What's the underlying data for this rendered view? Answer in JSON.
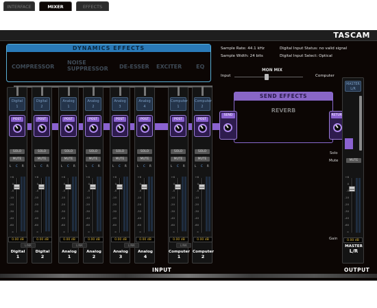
{
  "tabs": [
    {
      "label": "INTERFACE"
    },
    {
      "label": "MIXER"
    },
    {
      "label": "EFFECTS"
    }
  ],
  "brand": "TASCAM",
  "info": {
    "sample_rate": "Sample Rate: 44.1 kHz",
    "sample_width": "Sample Width: 24 bits",
    "digital_status": "Digital Input Status: no valid signal",
    "digital_select": "Digital Input Select: Optical"
  },
  "dynamics": {
    "title": "DYNAMICS EFFECTS",
    "items": [
      "COMPRESSOR",
      "NOISE\nSUPPRESSOR",
      "DE-ESSER",
      "EXCITER",
      "EQ"
    ]
  },
  "monmix": {
    "title": "MON MIX",
    "left": "Input",
    "right": "Computer"
  },
  "send_effects": {
    "title": "SEND EFFECTS",
    "effect": "REVERB",
    "send_label": "SEND",
    "return_label": "RETURN"
  },
  "channels": [
    {
      "btn1": "Digital",
      "btn2": "1",
      "name1": "Digital",
      "name2": "1",
      "db": "0.00 dB"
    },
    {
      "btn1": "Digital",
      "btn2": "2",
      "name1": "Digital",
      "name2": "2",
      "db": "0.00 dB"
    },
    {
      "btn1": "Analog",
      "btn2": "1",
      "name1": "Analog",
      "name2": "1",
      "db": "0.00 dB"
    },
    {
      "btn1": "Analog",
      "btn2": "2",
      "name1": "Analog",
      "name2": "2",
      "db": "0.00 dB"
    },
    {
      "btn1": "Analog",
      "btn2": "3",
      "name1": "Analog",
      "name2": "3",
      "db": "0.00 dB"
    },
    {
      "btn1": "Analog",
      "btn2": "4",
      "name1": "Analog",
      "name2": "4",
      "db": "0.00 dB"
    },
    {
      "btn1": "Computer",
      "btn2": "1",
      "name1": "Computer",
      "name2": "1",
      "db": "0.00 dB"
    },
    {
      "btn1": "Computer",
      "btn2": "2",
      "name1": "Computer",
      "name2": "2",
      "db": "0.00 dB"
    }
  ],
  "strip_labels": {
    "post": "POST",
    "solo": "SOLO",
    "mute": "MUTE",
    "l": "L",
    "c": "C",
    "r": "R",
    "link": "LINK"
  },
  "scale": [
    "+6",
    "0",
    "-5",
    "-10",
    "-20",
    "-30",
    "-40",
    "-60",
    "∞"
  ],
  "master": {
    "btn1": "MASTER",
    "btn2": "L/R",
    "mute": "MUTE",
    "name1": "MASTER",
    "name2": "L/R",
    "db": "0.00 dB"
  },
  "side_labels": {
    "solo": "Solo",
    "mute": "Mute",
    "gain": "Gain"
  },
  "sections": {
    "input": "INPUT",
    "output": "OUTPUT"
  },
  "colors": {
    "accent_purple": "#8a62d0",
    "accent_blue": "#2a7ab8",
    "db_text": "#e8c040"
  }
}
